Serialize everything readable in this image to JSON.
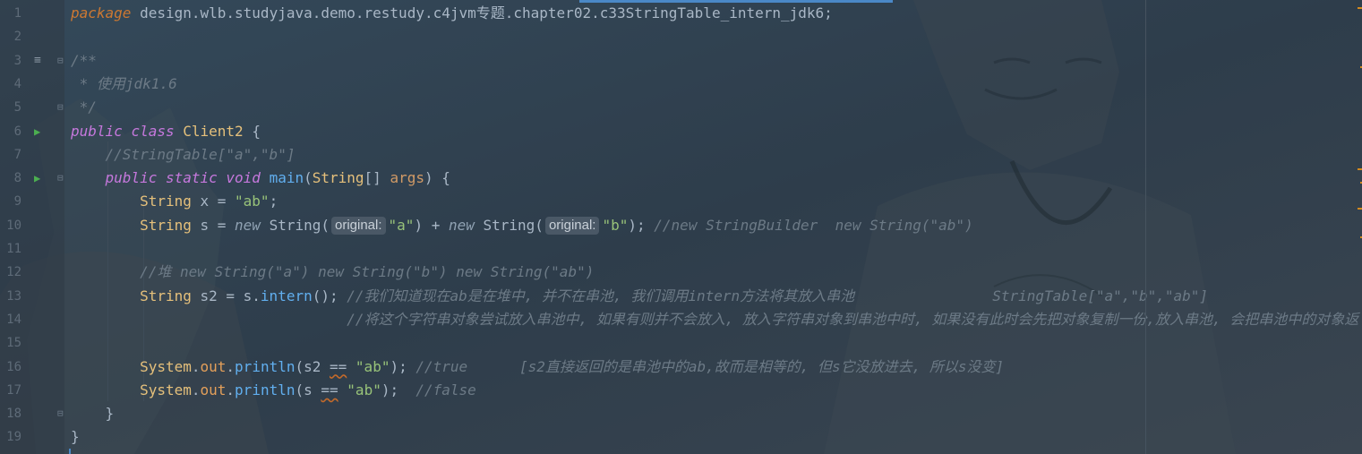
{
  "editor": {
    "lines": [
      {
        "num": "1",
        "tokens": [
          [
            "kw",
            "package"
          ],
          [
            "txt",
            " design.wlb.studyjava.demo.restudy.c4jvm专题.chapter02.c33StringTable_intern_jdk6;"
          ]
        ]
      },
      {
        "num": "2",
        "tokens": []
      },
      {
        "num": "3",
        "tokens": [
          [
            "doc",
            "/**"
          ]
        ]
      },
      {
        "num": "4",
        "tokens": [
          [
            "doc",
            " * 使用jdk1.6"
          ]
        ]
      },
      {
        "num": "5",
        "tokens": [
          [
            "doc",
            " */"
          ]
        ]
      },
      {
        "num": "6",
        "tokens": [
          [
            "kwp",
            "public"
          ],
          [
            "txt",
            " "
          ],
          [
            "kwp",
            "class"
          ],
          [
            "txt",
            " "
          ],
          [
            "cls",
            "Client2"
          ],
          [
            "txt",
            " {"
          ]
        ]
      },
      {
        "num": "7",
        "tokens": [
          [
            "txt",
            "    "
          ],
          [
            "com",
            "//StringTable[\"a\",\"b\"]"
          ]
        ]
      },
      {
        "num": "8",
        "tokens": [
          [
            "txt",
            "    "
          ],
          [
            "kwp",
            "public"
          ],
          [
            "txt",
            " "
          ],
          [
            "kwp",
            "static"
          ],
          [
            "txt",
            " "
          ],
          [
            "kwp",
            "void"
          ],
          [
            "txt",
            " "
          ],
          [
            "fn",
            "main"
          ],
          [
            "txt",
            "("
          ],
          [
            "cls",
            "String"
          ],
          [
            "txt",
            "[] "
          ],
          [
            "param",
            "args"
          ],
          [
            "txt",
            ") {"
          ]
        ]
      },
      {
        "num": "9",
        "tokens": [
          [
            "txt",
            "        "
          ],
          [
            "cls",
            "String"
          ],
          [
            "txt",
            " x = "
          ],
          [
            "str",
            "\"ab\""
          ],
          [
            "txt",
            ";"
          ]
        ]
      },
      {
        "num": "10",
        "tokens": [
          [
            "txt",
            "        "
          ],
          [
            "cls",
            "String"
          ],
          [
            "txt",
            " s = "
          ],
          [
            "kw2",
            "new"
          ],
          [
            "txt",
            " String("
          ],
          [
            "hint",
            "original:"
          ],
          [
            "str",
            "\"a\""
          ],
          [
            "txt",
            ") + "
          ],
          [
            "kw2",
            "new"
          ],
          [
            "txt",
            " String("
          ],
          [
            "hint",
            "original:"
          ],
          [
            "str",
            "\"b\""
          ],
          [
            "txt",
            "); "
          ],
          [
            "com",
            "//new StringBuilder  new String(\"ab\")"
          ]
        ]
      },
      {
        "num": "11",
        "tokens": []
      },
      {
        "num": "12",
        "tokens": [
          [
            "txt",
            "        "
          ],
          [
            "com",
            "//堆 new String(\"a\") new String(\"b\") new String(\"ab\")"
          ]
        ]
      },
      {
        "num": "13",
        "tokens": [
          [
            "txt",
            "        "
          ],
          [
            "cls",
            "String"
          ],
          [
            "txt",
            " s2 = s."
          ],
          [
            "fn",
            "intern"
          ],
          [
            "txt",
            "(); "
          ],
          [
            "com",
            "//我们知道现在ab是在堆中, 并不在串池, 我们调用intern方法将其放入串池                StringTable[\"a\",\"b\",\"ab\"]"
          ]
        ]
      },
      {
        "num": "14",
        "tokens": [
          [
            "txt",
            "                                "
          ],
          [
            "com",
            "//将这个字符串对象尝试放入串池中, 如果有则并不会放入, 放入字符串对象到串池中时, 如果没有此时会先把对象复制一份,放入串池, 会把串池中的对象返"
          ]
        ]
      },
      {
        "num": "15",
        "tokens": []
      },
      {
        "num": "16",
        "tokens": [
          [
            "txt",
            "        "
          ],
          [
            "cls",
            "System"
          ],
          [
            "txt",
            "."
          ],
          [
            "field",
            "out"
          ],
          [
            "txt",
            "."
          ],
          [
            "fn",
            "println"
          ],
          [
            "txt",
            "(s2 "
          ],
          [
            "sq",
            "=="
          ],
          [
            "txt",
            " "
          ],
          [
            "str",
            "\"ab\""
          ],
          [
            "txt",
            "); "
          ],
          [
            "com",
            "//true      [s2直接返回的是串池中的ab,故而是相等的, 但s它没放进去, 所以s没变]"
          ]
        ]
      },
      {
        "num": "17",
        "tokens": [
          [
            "txt",
            "        "
          ],
          [
            "cls",
            "System"
          ],
          [
            "txt",
            "."
          ],
          [
            "field",
            "out"
          ],
          [
            "txt",
            "."
          ],
          [
            "fn",
            "println"
          ],
          [
            "txt",
            "(s "
          ],
          [
            "sq",
            "=="
          ],
          [
            "txt",
            " "
          ],
          [
            "str",
            "\"ab\""
          ],
          [
            "txt",
            ");  "
          ],
          [
            "com",
            "//false"
          ]
        ]
      },
      {
        "num": "18",
        "tokens": [
          [
            "txt",
            "    }"
          ]
        ]
      },
      {
        "num": "19",
        "tokens": [
          [
            "txt",
            "}"
          ]
        ]
      }
    ],
    "gutter_icons": {
      "3": [
        "bookmark",
        "fold"
      ],
      "5": [
        "fold"
      ],
      "6": [
        "run"
      ],
      "8": [
        "run",
        "fold"
      ],
      "18": [
        "fold"
      ]
    }
  },
  "colors": {
    "background": "#2f3f4e",
    "keyword": "#c678dd",
    "string": "#98c379",
    "class": "#e5c07b",
    "comment": "#6c7a86",
    "function": "#61afef"
  }
}
